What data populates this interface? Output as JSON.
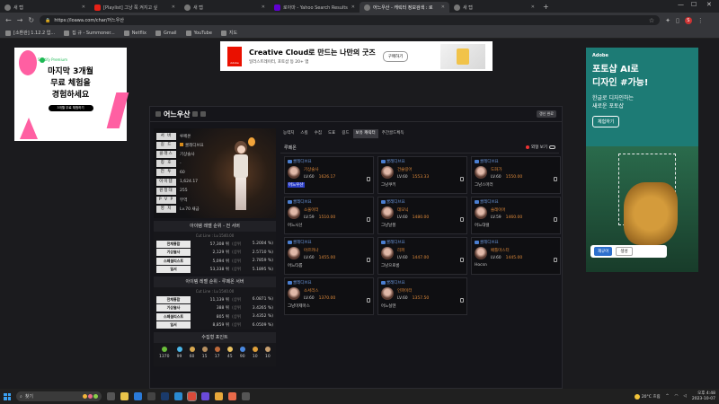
{
  "browser": {
    "tabs": [
      {
        "title": "새 탭",
        "icon": "page-icon",
        "active": false
      },
      {
        "title": "[Playlist] 그냥 쭉 켜지고 싶",
        "icon": "youtube-icon",
        "active": false
      },
      {
        "title": "새 탭",
        "icon": "page-icon",
        "active": false
      },
      {
        "title": "로아마 - Yahoo Search Results",
        "icon": "yahoo-icon",
        "active": false
      },
      {
        "title": "어느우산 - 캐릭터 정보검색 : 로",
        "icon": "page-icon",
        "active": true
      },
      {
        "title": "새 탭",
        "icon": "page-icon",
        "active": false
      }
    ],
    "new_tab": "+",
    "url_host": "https://loawa.com",
    "url_path": "/char/어느우산",
    "bookmarks": [
      "[소환관] 1.12.2 업...",
      "집 규 - Summoner...",
      "Netflix",
      "Gmail",
      "YouTube",
      "지도"
    ]
  },
  "ads": {
    "left": {
      "brand": "Spotify Premium",
      "line1": "마지막 3개월",
      "line2": "무료 체험을",
      "line3": "경험하세요",
      "cta": "3개월 무료 체험하기"
    },
    "top": {
      "logo": "Adobe",
      "headline": "Creative Cloud로 만드는 나만의 굿즈",
      "sub": "일러스트레이터, 포토샵 등 20+ 앱",
      "cta": "구매하기"
    },
    "right": {
      "brand": "Adobe",
      "h1": "포토샵 AI로",
      "h2": "디자인 #가능!",
      "s1": "한글로 디자인하는",
      "s2": "새로운 포토샵",
      "cta": "체험하기",
      "btn1": "재규어",
      "btn2": "생성"
    }
  },
  "character": {
    "name": "어느우산",
    "update_label": "갱신 완료",
    "info": [
      {
        "k": "서 버",
        "v": "루페온"
      },
      {
        "k": "길 드",
        "v": "쿨레디브요"
      },
      {
        "k": "클래스",
        "v": "기상술사"
      },
      {
        "k": "칭 호",
        "v": "-"
      },
      {
        "k": "전 투",
        "v": "60"
      },
      {
        "k": "아이템",
        "v": "1,624.17"
      },
      {
        "k": "원정대",
        "v": "255"
      },
      {
        "k": "P V P",
        "v": "무역"
      },
      {
        "k": "영 지",
        "v": "Lv.70 새금"
      }
    ]
  },
  "ranking_all": {
    "title": "아이템 레벨 순위 - 전 서버",
    "cutline": "Cut Line : Lv.1540.00",
    "rows": [
      {
        "label": "전체통합",
        "num": "57,308 위",
        "sub": "(상위",
        "pct": "5.2004 %)"
      },
      {
        "label": "기상술사",
        "num": "2,129 위",
        "sub": "(상위",
        "pct": "2.5710 %)"
      },
      {
        "label": "스페셜리스트",
        "num": "5,094 위",
        "sub": "(상위",
        "pct": "2.7859 %)"
      },
      {
        "label": "일서",
        "num": "53,338 위",
        "sub": "(상위",
        "pct": "5.1895 %)"
      }
    ]
  },
  "ranking_server": {
    "title": "아이템 레벨 순위 - 루페온 서버",
    "cutline": "Cut Line : Lv.1540.00",
    "rows": [
      {
        "label": "전체통합",
        "num": "11,139 위",
        "sub": "(상위",
        "pct": "6.0871 %)"
      },
      {
        "label": "기상술사",
        "num": "388 위",
        "sub": "(상위",
        "pct": "3.4265 %)"
      },
      {
        "label": "스페셜리스트",
        "num": "805 위",
        "sub": "(상위",
        "pct": "3.4352 %)"
      },
      {
        "label": "일서",
        "num": "8,859 위",
        "sub": "(상위",
        "pct": "6.0509 %)"
      }
    ]
  },
  "collection": {
    "title": "수집형 포인트",
    "items": [
      {
        "v": "1370",
        "color": "#6bbf3a"
      },
      {
        "v": "99",
        "color": "#4ab6e8"
      },
      {
        "v": "60",
        "color": "#d8a850"
      },
      {
        "v": "15",
        "color": "#b89060"
      },
      {
        "v": "17",
        "color": "#c06a3a"
      },
      {
        "v": "45",
        "color": "#e8c060"
      },
      {
        "v": "90",
        "color": "#4a88e0"
      },
      {
        "v": "10",
        "color": "#e0a03a"
      },
      {
        "v": "10",
        "color": "#c8a070"
      }
    ]
  },
  "tabs": [
    "능력치",
    "스킬",
    "수집",
    "도표",
    "길드",
    "보유 캐릭터",
    "주간골드획득"
  ],
  "active_tab": 5,
  "server_bar": {
    "name": "루페온",
    "toggle_label": "외형 보기"
  },
  "roster": [
    {
      "guild": "쿨레디브요",
      "cls": "기상술사",
      "lv": "LV.60",
      "il": "1626.17",
      "name": "어느우산",
      "hl": true
    },
    {
      "guild": "쿨레디브요",
      "cls": "건슬링어",
      "lv": "LV.60",
      "il": "1553.33",
      "name": "그냥쿠키",
      "hl": false
    },
    {
      "guild": "쿨레디브요",
      "cls": "도화가",
      "lv": "LV.60",
      "il": "1550.00",
      "name": "그냥스마러",
      "hl": false
    },
    {
      "guild": "쿨레디브요",
      "cls": "소울이터",
      "lv": "LV.59",
      "il": "1510.00",
      "name": "어느시선",
      "hl": false
    },
    {
      "guild": "쿨레디브요",
      "cls": "데모닉",
      "lv": "LV.60",
      "il": "1480.00",
      "name": "그냥날풍",
      "hl": false
    },
    {
      "guild": "쿨레디브요",
      "cls": "슬레이어",
      "lv": "LV.59",
      "il": "1460.00",
      "name": "어느대럴",
      "hl": false
    },
    {
      "guild": "쿨레디브요",
      "cls": "아르카나",
      "lv": "LV.60",
      "il": "1455.00",
      "name": "어느타롭",
      "hl": false
    },
    {
      "guild": "쿨레디브요",
      "cls": "리퍼",
      "lv": "LV.60",
      "il": "1447.00",
      "name": "그냥으로롱",
      "hl": false
    },
    {
      "guild": "쿨레디브요",
      "cls": "배틀마스터",
      "lv": "LV.60",
      "il": "1445.00",
      "name": "Hocsn",
      "hl": false
    },
    {
      "guild": "쿨레디브요",
      "cls": "소서리스",
      "lv": "LV.60",
      "il": "1370.00",
      "name": "그냥마제마스",
      "hl": false
    },
    {
      "guild": "쿨레디브요",
      "cls": "인파이터",
      "lv": "LV.60",
      "il": "1357.50",
      "name": "어느실텐",
      "hl": false
    }
  ],
  "taskbar": {
    "search_placeholder": "찾기",
    "weather": "20°C 흐림",
    "time": "오후 4:48",
    "date": "2023-10-07"
  }
}
